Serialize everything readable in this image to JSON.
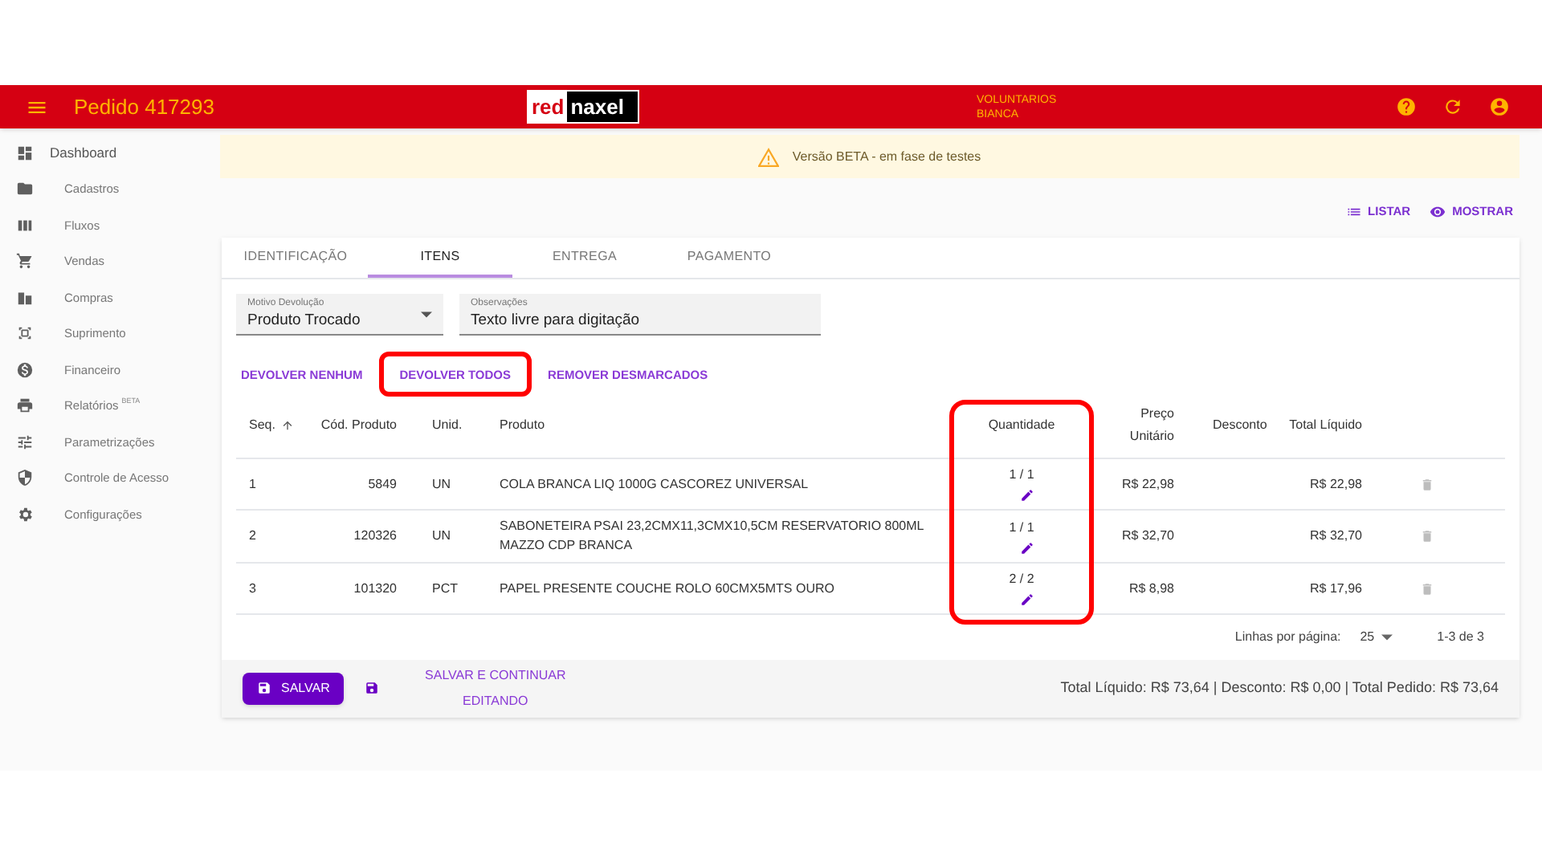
{
  "app_bar": {
    "title": "Pedido 417293",
    "logo": [
      "red",
      "naxel"
    ],
    "user_lines": [
      "VOLUNTARIOS",
      "BIANCA"
    ]
  },
  "sidebar": {
    "items": [
      {
        "label": "Dashboard",
        "kind": "top"
      },
      {
        "label": "Cadastros",
        "kind": "sub"
      },
      {
        "label": "Fluxos",
        "kind": "sub"
      },
      {
        "label": "Vendas",
        "kind": "sub"
      },
      {
        "label": "Compras",
        "kind": "sub"
      },
      {
        "label": "Suprimento",
        "kind": "sub"
      },
      {
        "label": "Financeiro",
        "kind": "sub"
      },
      {
        "label": "Relatórios",
        "kind": "sub",
        "badge": "BETA"
      },
      {
        "label": "Parametrizações",
        "kind": "sub"
      },
      {
        "label": "Controle de Acesso",
        "kind": "sub"
      },
      {
        "label": "Configurações",
        "kind": "sub"
      }
    ]
  },
  "banner": "Versão BETA - em fase de testes",
  "view_actions": [
    "LISTAR",
    "MOSTRAR"
  ],
  "tabs": [
    {
      "label": "IDENTIFICAÇÃO",
      "selected": false
    },
    {
      "label": "ITENS",
      "selected": true
    },
    {
      "label": "ENTREGA",
      "selected": false
    },
    {
      "label": "PAGAMENTO",
      "selected": false
    }
  ],
  "fields": [
    {
      "kind": "select",
      "label": "Motivo Devolução",
      "value": "Produto Trocado"
    },
    {
      "kind": "text",
      "label": "Observações",
      "value": "Texto livre para digitação"
    }
  ],
  "actions": [
    {
      "label": "DEVOLVER NENHUM",
      "highlighted": false
    },
    {
      "label": "DEVOLVER TODOS",
      "highlighted": true
    },
    {
      "label": "REMOVER DESMARCADOS",
      "highlighted": false
    }
  ],
  "table": {
    "columns": [
      {
        "label": "Seq.",
        "highlighted": false
      },
      {
        "label": "Cód. Produto",
        "highlighted": false
      },
      {
        "label": "Unid.",
        "highlighted": false
      },
      {
        "label": "Produto",
        "highlighted": false
      },
      {
        "label": "Quantidade",
        "highlighted": true
      },
      {
        "label": "Preço Unitário",
        "highlighted": false
      },
      {
        "label": "Desconto",
        "highlighted": false
      },
      {
        "label": "Total Líquido",
        "highlighted": false
      }
    ],
    "rows": [
      {
        "seq": "1",
        "code": "5849",
        "unit": "UN",
        "product": "COLA BRANCA LIQ 1000G CASCOREZ UNIVERSAL",
        "quantity": "1 / 1",
        "price": "R$ 22,98",
        "total": "R$ 22,98"
      },
      {
        "seq": "2",
        "code": "120326",
        "unit": "UN",
        "product": "SABONETEIRA PSAI 23,2CMX11,3CMX10,5CM RESERVATORIO 800ML MAZZO CDP BRANCA",
        "quantity": "1 / 1",
        "price": "R$ 32,70",
        "total": "R$ 32,70"
      },
      {
        "seq": "3",
        "code": "101320",
        "unit": "PCT",
        "product": "PAPEL PRESENTE COUCHE ROLO 60CMX5MTS OURO",
        "quantity": "2 / 2",
        "price": "R$ 8,98",
        "total": "R$ 17,96"
      }
    ]
  },
  "pagination": {
    "label": "Linhas por página:",
    "per_page": "25",
    "range": "1-3 de 3"
  },
  "footer": {
    "save": "SALVAR",
    "save_continue": "SALVAR E CONTINUAR EDITANDO",
    "totals": "Total Líquido: R$ 73,64 | Desconto: R$ 0,00 | Total Pedido: R$ 73,64"
  }
}
